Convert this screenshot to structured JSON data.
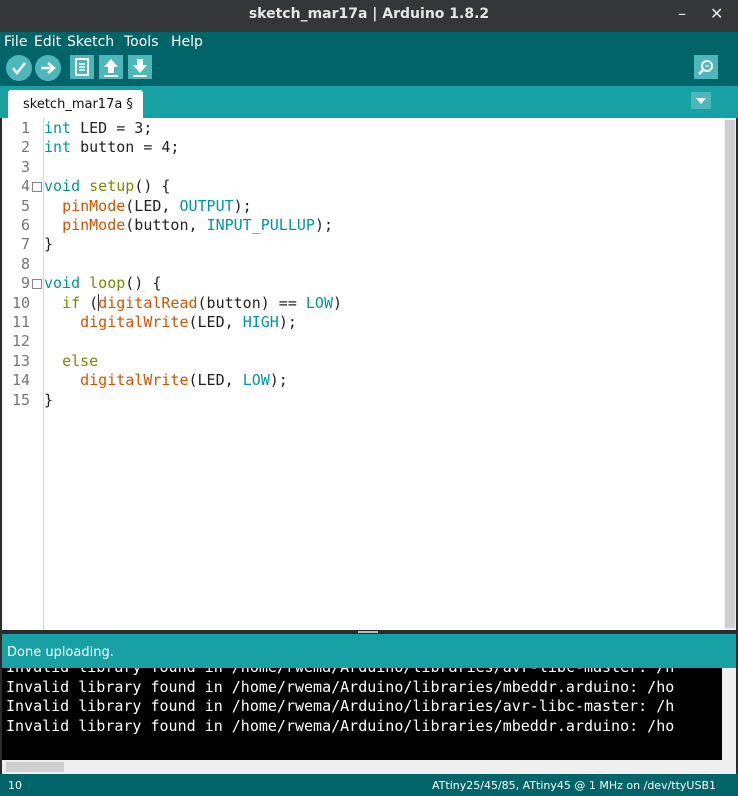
{
  "window": {
    "title": "sketch_mar17a | Arduino 1.8.2",
    "minimize_glyph": "–",
    "close_glyph": "✕"
  },
  "menu": [
    "File",
    "Edit",
    "Sketch",
    "Tools",
    "Help"
  ],
  "toolbar": {
    "verify_icon": "✓",
    "upload_icon": "➜",
    "new_icon": "new-file-icon",
    "open_icon": "open-arrow-icon",
    "save_icon": "save-arrow-icon",
    "serial_monitor_icon": "magnifier-icon"
  },
  "tab": {
    "label": "sketch_mar17a §"
  },
  "editor": {
    "line_numbers": [
      "1",
      "2",
      "3",
      "4",
      "5",
      "6",
      "7",
      "8",
      "9",
      "10",
      "11",
      "12",
      "13",
      "14",
      "15"
    ],
    "lines": [
      [
        {
          "t": "int",
          "c": "kw"
        },
        {
          "t": " LED = 3;",
          "c": ""
        }
      ],
      [
        {
          "t": "int",
          "c": "kw"
        },
        {
          "t": " button = 4;",
          "c": ""
        }
      ],
      [],
      [
        {
          "t": "void",
          "c": "kw"
        },
        {
          "t": " ",
          "c": ""
        },
        {
          "t": "setup",
          "c": "kw2"
        },
        {
          "t": "() {",
          "c": ""
        }
      ],
      [
        {
          "t": "  ",
          "c": ""
        },
        {
          "t": "pinMode",
          "c": "fn"
        },
        {
          "t": "(LED, ",
          "c": ""
        },
        {
          "t": "OUTPUT",
          "c": "ct"
        },
        {
          "t": ");",
          "c": ""
        }
      ],
      [
        {
          "t": "  ",
          "c": ""
        },
        {
          "t": "pinMode",
          "c": "fn"
        },
        {
          "t": "(button, ",
          "c": ""
        },
        {
          "t": "INPUT_PULLUP",
          "c": "ct"
        },
        {
          "t": ");",
          "c": ""
        }
      ],
      [
        {
          "t": "}",
          "c": ""
        }
      ],
      [],
      [
        {
          "t": "void",
          "c": "kw"
        },
        {
          "t": " ",
          "c": ""
        },
        {
          "t": "loop",
          "c": "kw2"
        },
        {
          "t": "() {",
          "c": ""
        }
      ],
      [
        {
          "t": "  ",
          "c": ""
        },
        {
          "t": "if",
          "c": "kw2"
        },
        {
          "t": " (",
          "c": ""
        },
        {
          "t": "digitalRead",
          "c": "fn"
        },
        {
          "t": "(button) == ",
          "c": ""
        },
        {
          "t": "LOW",
          "c": "ct"
        },
        {
          "t": ")",
          "c": ""
        }
      ],
      [
        {
          "t": "    ",
          "c": ""
        },
        {
          "t": "digitalWrite",
          "c": "fn"
        },
        {
          "t": "(LED, ",
          "c": ""
        },
        {
          "t": "HIGH",
          "c": "ct"
        },
        {
          "t": ");",
          "c": ""
        }
      ],
      [],
      [
        {
          "t": "  ",
          "c": ""
        },
        {
          "t": "else",
          "c": "kw2"
        }
      ],
      [
        {
          "t": "    ",
          "c": ""
        },
        {
          "t": "digitalWrite",
          "c": "fn"
        },
        {
          "t": "(LED, ",
          "c": ""
        },
        {
          "t": "LOW",
          "c": "ct"
        },
        {
          "t": ");",
          "c": ""
        }
      ],
      [
        {
          "t": "}",
          "c": ""
        }
      ]
    ],
    "fold_lines": [
      4,
      9
    ]
  },
  "status": {
    "message": "Done uploading."
  },
  "console": {
    "lines": [
      "Invalid library found in /home/rwema/Arduino/libraries/avr-libc-master: /h",
      "Invalid library found in /home/rwema/Arduino/libraries/mbeddr.arduino: /ho",
      "Invalid library found in /home/rwema/Arduino/libraries/avr-libc-master: /h",
      "Invalid library found in /home/rwema/Arduino/libraries/mbeddr.arduino: /ho"
    ]
  },
  "footer": {
    "line": "10",
    "board": "ATtiny25/45/85, ATtiny45 @ 1 MHz on /dev/ttyUSB1"
  }
}
